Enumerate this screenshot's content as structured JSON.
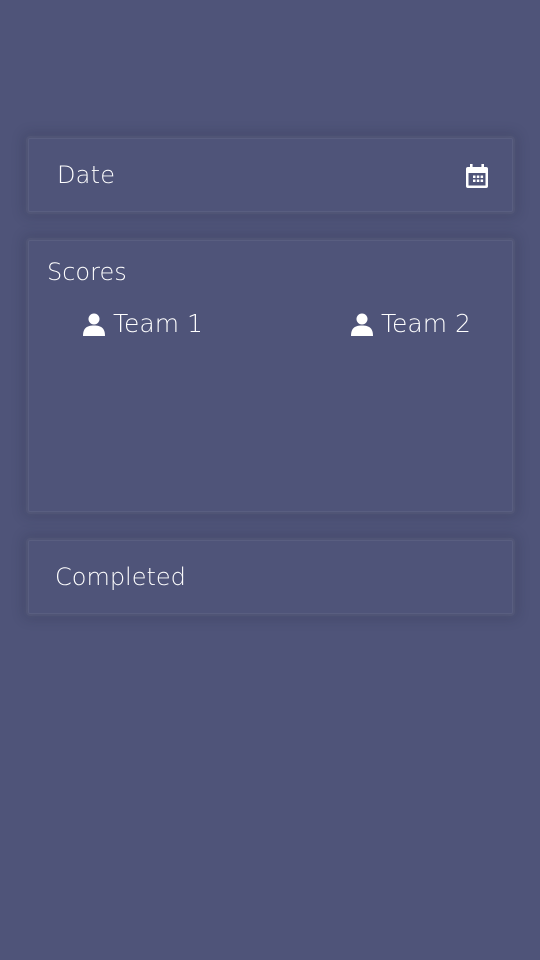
{
  "date_field": {
    "label": "Date",
    "icon": "calendar-icon"
  },
  "scores": {
    "title": "Scores",
    "teams": [
      {
        "label": "Team 1",
        "icon": "person-icon"
      },
      {
        "label": "Team 2",
        "icon": "person-icon"
      }
    ]
  },
  "completed": {
    "label": "Completed"
  },
  "colors": {
    "background": "#4f5479",
    "text": "#ffffff"
  }
}
